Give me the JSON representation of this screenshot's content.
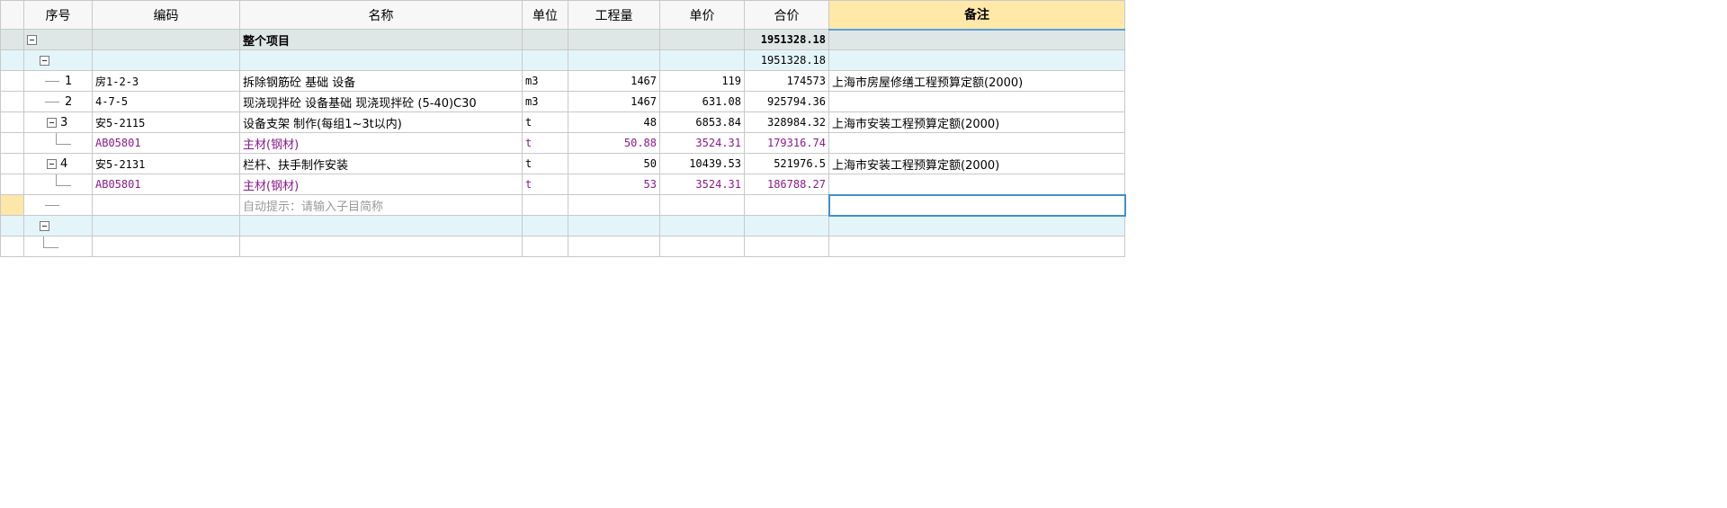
{
  "columns": [
    "序号",
    "编码",
    "名称",
    "单位",
    "工程量",
    "单价",
    "合价",
    "备注"
  ],
  "project_row": {
    "name": "整个项目",
    "total": "1951328.18"
  },
  "section_row": {
    "total": "1951328.18"
  },
  "items": [
    {
      "no": "1",
      "code": "房1-2-3",
      "name": "拆除钢筋砼 基础 设备",
      "unit": "m3",
      "qty": "1467",
      "price": "119",
      "total": "174573",
      "note": "上海市房屋修缮工程预算定额(2000)"
    },
    {
      "no": "2",
      "code": "4-7-5",
      "name": "现浇现拌砼 设备基础 现浇现拌砼 (5-40)C30",
      "unit": "m3",
      "qty": "1467",
      "price": "631.08",
      "total": "925794.36",
      "note": ""
    },
    {
      "no": "3",
      "code": "安5-2115",
      "name": "设备支架 制作(每组1~3t以内)",
      "unit": "t",
      "qty": "48",
      "price": "6853.84",
      "total": "328984.32",
      "note": "上海市安装工程预算定额(2000)"
    },
    {
      "code": "AB05801",
      "name": "主材(钢材)",
      "unit": "t",
      "qty": "50.88",
      "price": "3524.31",
      "total": "179316.74"
    },
    {
      "no": "4",
      "code": "安5-2131",
      "name": "栏杆、扶手制作安装",
      "unit": "t",
      "qty": "50",
      "price": "10439.53",
      "total": "521976.5",
      "note": "上海市安装工程预算定额(2000)"
    },
    {
      "code": "AB05801",
      "name": "主材(钢材)",
      "unit": "t",
      "qty": "53",
      "price": "3524.31",
      "total": "186788.27"
    }
  ],
  "hint_row": {
    "text": "自动提示：请输入子目简称"
  }
}
